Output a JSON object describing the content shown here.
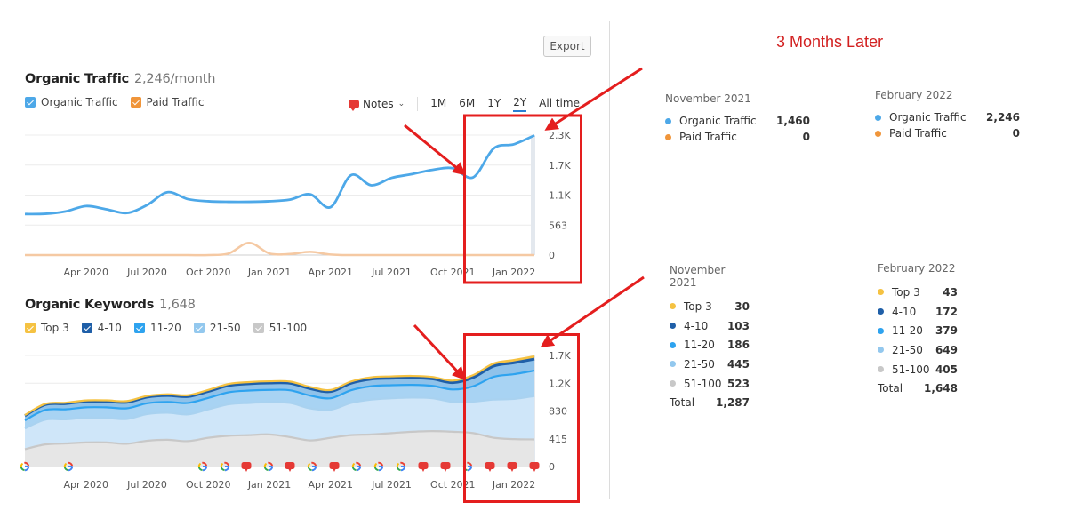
{
  "export_label": "Export",
  "headline": "3 Months Later",
  "traffic": {
    "title": "Organic Traffic",
    "metric": "2,246/month",
    "legend": [
      {
        "label": "Organic Traffic",
        "color": "#4da8e8"
      },
      {
        "label": "Paid Traffic",
        "color": "#f0953a"
      }
    ],
    "notes_label": "Notes",
    "periods": [
      {
        "label": "1M",
        "active": false
      },
      {
        "label": "6M",
        "active": false
      },
      {
        "label": "1Y",
        "active": false
      },
      {
        "label": "2Y",
        "active": true
      },
      {
        "label": "All time",
        "active": false
      }
    ]
  },
  "keywords": {
    "title": "Organic Keywords",
    "metric": "1,648",
    "legend": [
      {
        "label": "Top 3",
        "color": "#f5c242"
      },
      {
        "label": "4-10",
        "color": "#1f5fa8"
      },
      {
        "label": "11-20",
        "color": "#2ea3ef"
      },
      {
        "label": "21-50",
        "color": "#93c8ee"
      },
      {
        "label": "51-100",
        "color": "#c8c8c8"
      }
    ]
  },
  "chart_data": [
    {
      "type": "line",
      "title": "Organic Traffic",
      "x_tick_labels": [
        "Apr 2020",
        "Jul 2020",
        "Oct 2020",
        "Jan 2021",
        "Apr 2021",
        "Jul 2021",
        "Oct 2021",
        "Jan 2022"
      ],
      "y_tick_labels": [
        "0",
        "563",
        "1.1K",
        "1.7K",
        "2.3K"
      ],
      "y_ticks": [
        0,
        563,
        1126,
        1689,
        2252
      ],
      "ylim": [
        0,
        2252
      ],
      "x_months": [
        "2020-01",
        "2020-02",
        "2020-03",
        "2020-04",
        "2020-05",
        "2020-06",
        "2020-07",
        "2020-08",
        "2020-09",
        "2020-10",
        "2020-11",
        "2020-12",
        "2021-01",
        "2021-02",
        "2021-03",
        "2021-04",
        "2021-05",
        "2021-06",
        "2021-07",
        "2021-08",
        "2021-09",
        "2021-10",
        "2021-11",
        "2021-12",
        "2022-01",
        "2022-02"
      ],
      "series": [
        {
          "name": "Organic Traffic",
          "color": "#4da8e8",
          "values": [
            770,
            775,
            820,
            920,
            860,
            790,
            940,
            1180,
            1050,
            1010,
            1000,
            1000,
            1010,
            1040,
            1140,
            900,
            1500,
            1310,
            1450,
            1520,
            1600,
            1630,
            1460,
            2000,
            2080,
            2246
          ]
        },
        {
          "name": "Paid Traffic",
          "color": "#f5c9a3",
          "values": [
            0,
            0,
            0,
            0,
            0,
            0,
            0,
            0,
            0,
            0,
            30,
            230,
            30,
            20,
            60,
            10,
            0,
            0,
            0,
            0,
            0,
            0,
            0,
            0,
            0,
            0
          ]
        }
      ],
      "legend_position": "top-left",
      "grid": true
    },
    {
      "type": "area",
      "stacked": true,
      "title": "Organic Keywords",
      "x_tick_labels": [
        "Apr 2020",
        "Jul 2020",
        "Oct 2020",
        "Jan 2021",
        "Apr 2021",
        "Jul 2021",
        "Oct 2021",
        "Jan 2022"
      ],
      "y_tick_labels": [
        "0",
        "415",
        "830",
        "1.2K",
        "1.7K"
      ],
      "y_ticks": [
        0,
        415,
        830,
        1245,
        1660
      ],
      "ylim": [
        0,
        1660
      ],
      "x_months": [
        "2020-01",
        "2020-02",
        "2020-03",
        "2020-04",
        "2020-05",
        "2020-06",
        "2020-07",
        "2020-08",
        "2020-09",
        "2020-10",
        "2020-11",
        "2020-12",
        "2021-01",
        "2021-02",
        "2021-03",
        "2021-04",
        "2021-05",
        "2021-06",
        "2021-07",
        "2021-08",
        "2021-09",
        "2021-10",
        "2021-11",
        "2021-12",
        "2022-01",
        "2022-02"
      ],
      "series": [
        {
          "name": "51-100",
          "color": "#c8c8c8",
          "fill": "#e6e6e6",
          "values": [
            260,
            330,
            345,
            360,
            360,
            340,
            385,
            400,
            380,
            430,
            460,
            470,
            480,
            440,
            390,
            430,
            470,
            480,
            500,
            520,
            530,
            520,
            500,
            430,
            410,
            405
          ]
        },
        {
          "name": "21-50",
          "color": "#a9d2f0",
          "fill": "#cfe6f9",
          "values": [
            310,
            370,
            360,
            370,
            365,
            370,
            400,
            405,
            400,
            425,
            470,
            480,
            480,
            510,
            480,
            420,
            480,
            520,
            520,
            510,
            490,
            445,
            470,
            570,
            600,
            649
          ]
        },
        {
          "name": "11-20",
          "color": "#2ea3ef",
          "fill": "#a8d3f3",
          "values": [
            120,
            145,
            150,
            155,
            160,
            160,
            160,
            160,
            170,
            170,
            180,
            185,
            185,
            190,
            190,
            170,
            190,
            200,
            195,
            190,
            185,
            186,
            230,
            340,
            370,
            379
          ]
        },
        {
          "name": "4-10",
          "color": "#1f5fa8",
          "fill": "#8fc2ea",
          "values": [
            70,
            80,
            85,
            88,
            88,
            90,
            92,
            95,
            96,
            98,
            100,
            102,
            103,
            104,
            104,
            100,
            104,
            106,
            104,
            105,
            104,
            103,
            130,
            160,
            170,
            172
          ]
        },
        {
          "name": "Top 3",
          "color": "#f5c242",
          "fill": "#f5c242",
          "values": [
            10,
            12,
            14,
            15,
            16,
            18,
            18,
            20,
            20,
            22,
            24,
            25,
            26,
            26,
            26,
            24,
            26,
            28,
            28,
            29,
            30,
            30,
            36,
            40,
            42,
            43
          ]
        }
      ],
      "annotations_row": [
        "G",
        "G",
        "G",
        "G",
        "note",
        "G",
        "note",
        "G",
        "note",
        "G",
        "G",
        "G",
        "note",
        "note",
        "G",
        "note",
        "note",
        "note"
      ],
      "legend_position": "top-left",
      "grid": true
    }
  ],
  "traffic_stats": [
    {
      "date": "November 2021",
      "rows": [
        {
          "label": "Organic Traffic",
          "value": "1,460",
          "color": "#4da8e8"
        },
        {
          "label": "Paid Traffic",
          "value": "0",
          "color": "#f0953a"
        }
      ]
    },
    {
      "date": "February 2022",
      "rows": [
        {
          "label": "Organic Traffic",
          "value": "2,246",
          "color": "#4da8e8"
        },
        {
          "label": "Paid Traffic",
          "value": "0",
          "color": "#f0953a"
        }
      ]
    }
  ],
  "keyword_stats": [
    {
      "date": "November 2021",
      "rows": [
        {
          "label": "Top 3",
          "value": "30",
          "color": "#f5c242"
        },
        {
          "label": "4-10",
          "value": "103",
          "color": "#1f5fa8"
        },
        {
          "label": "11-20",
          "value": "186",
          "color": "#2ea3ef"
        },
        {
          "label": "21-50",
          "value": "445",
          "color": "#93c8ee"
        },
        {
          "label": "51-100",
          "value": "523",
          "color": "#c8c8c8"
        }
      ],
      "total_label": "Total",
      "total": "1,287"
    },
    {
      "date": "February 2022",
      "rows": [
        {
          "label": "Top 3",
          "value": "43",
          "color": "#f5c242"
        },
        {
          "label": "4-10",
          "value": "172",
          "color": "#1f5fa8"
        },
        {
          "label": "11-20",
          "value": "379",
          "color": "#2ea3ef"
        },
        {
          "label": "21-50",
          "value": "649",
          "color": "#93c8ee"
        },
        {
          "label": "51-100",
          "value": "405",
          "color": "#c8c8c8"
        }
      ],
      "total_label": "Total",
      "total": "1,648"
    }
  ],
  "highlight_color": "#e41e1e"
}
